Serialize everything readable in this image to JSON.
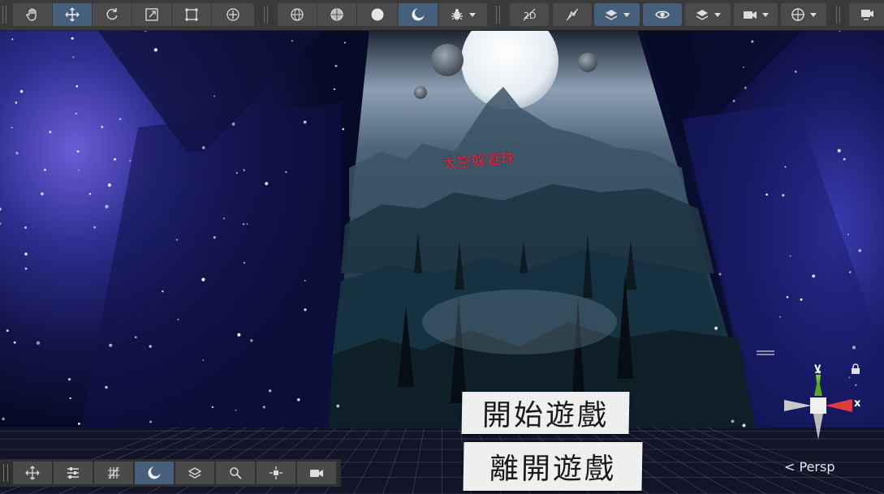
{
  "scene": {
    "title_text": "太空躲避球",
    "start_button_label": "開始遊戲",
    "exit_button_label": "離開遊戲",
    "view_mode_label": "< Persp",
    "gizmo_axes": {
      "x": "x",
      "y": "y"
    }
  },
  "toolbar": {
    "tools": [
      {
        "name": "hand-tool",
        "icon": "hand-icon"
      },
      {
        "name": "move-tool",
        "icon": "move-icon",
        "active": true
      },
      {
        "name": "rotate-tool",
        "icon": "rotate-icon"
      },
      {
        "name": "scale-tool",
        "icon": "scale-icon"
      },
      {
        "name": "rect-tool",
        "icon": "rect-transform-icon"
      },
      {
        "name": "transform-tool",
        "icon": "transform-icon"
      }
    ],
    "shading_modes": [
      "wireframe",
      "shaded-wireframe",
      "shaded",
      "lit"
    ],
    "toggles": [
      "2d-toggle",
      "lighting-toggle",
      "gizmos-toggle",
      "visibility-toggle",
      "layers-toggle",
      "camera-toggle",
      "gizmo-menu"
    ]
  },
  "colors": {
    "toolbar_bg": "#3a3a3a",
    "button_bg": "#4b4b4b",
    "active_bg": "#46607c",
    "title_red": "#e0283c",
    "axis_x": "#e03a3a",
    "axis_y": "#7ad03a"
  }
}
